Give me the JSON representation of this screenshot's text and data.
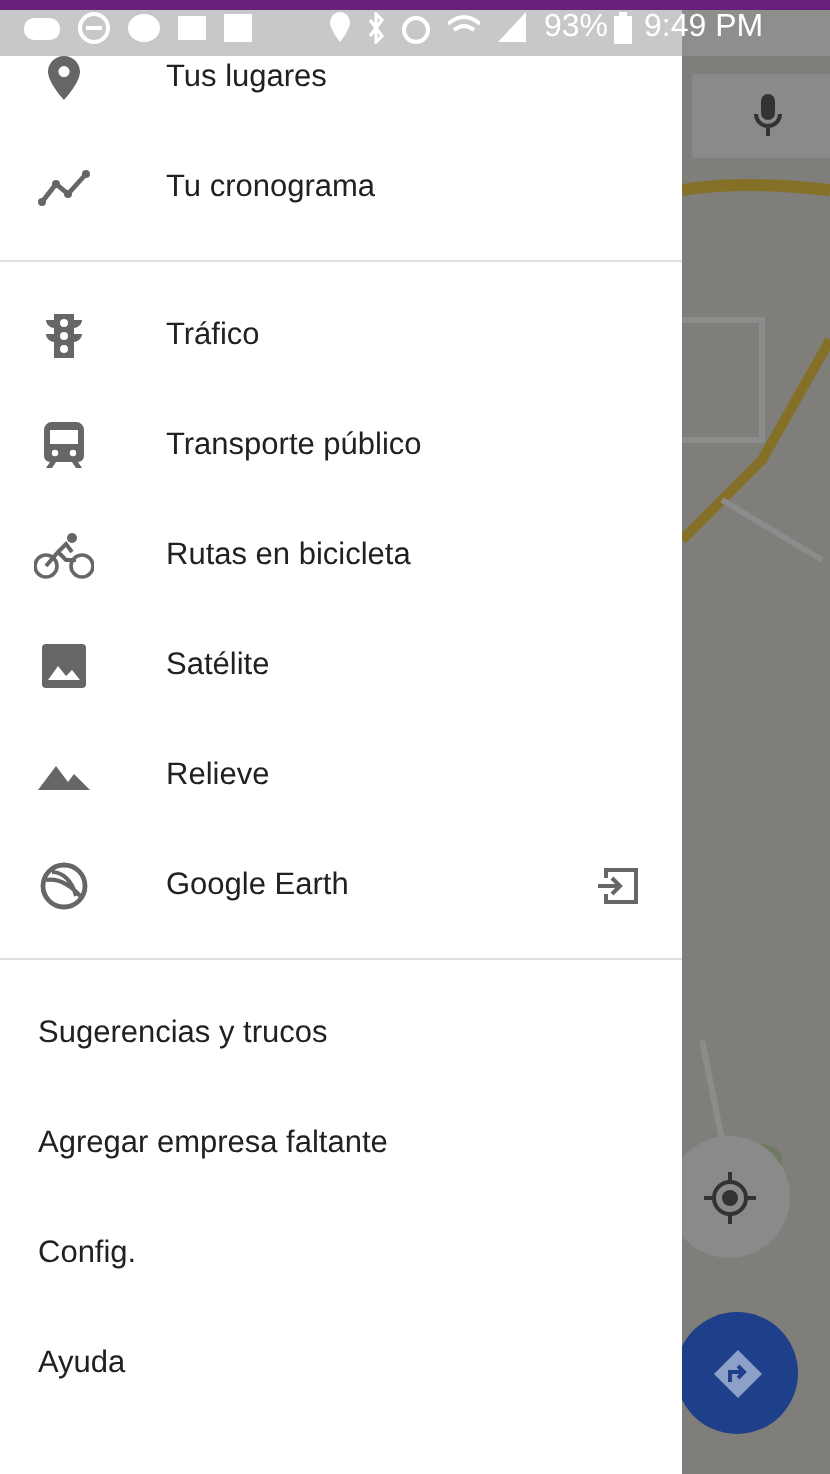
{
  "status_bar": {
    "battery": "93%",
    "time": "9:49 PM"
  },
  "drawer": {
    "sections": [
      {
        "items": [
          {
            "label": "Tus lugares",
            "kind": "icon"
          },
          {
            "label": "Tu cronograma",
            "kind": "icon"
          }
        ]
      },
      {
        "items": [
          {
            "label": "Tráfico",
            "kind": "icon"
          },
          {
            "label": "Transporte público",
            "kind": "icon"
          },
          {
            "label": "Rutas en bicicleta",
            "kind": "icon"
          },
          {
            "label": "Satélite",
            "kind": "icon"
          },
          {
            "label": "Relieve",
            "kind": "icon"
          },
          {
            "label": "Google Earth",
            "kind": "icon_action"
          }
        ]
      },
      {
        "items": [
          {
            "label": "Sugerencias y trucos",
            "kind": "text"
          },
          {
            "label": "Agregar empresa faltante",
            "kind": "text"
          },
          {
            "label": "Config.",
            "kind": "text"
          },
          {
            "label": "Ayuda",
            "kind": "text"
          }
        ]
      }
    ]
  }
}
